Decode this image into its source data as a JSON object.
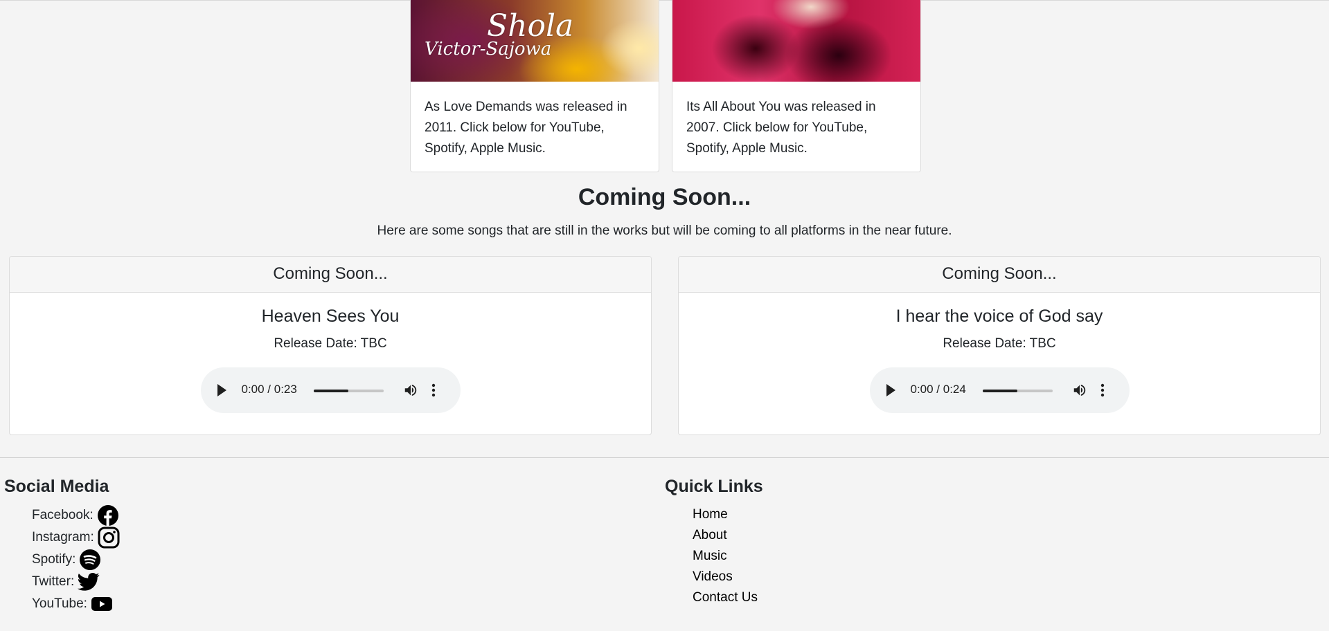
{
  "albums": [
    {
      "script_name": "Shola",
      "script_sub": "Victor-Sajowa",
      "description": "As Love Demands was released in 2011. Click below for YouTube, Spotify, Apple Music."
    },
    {
      "description": "Its All About You was released in 2007. Click below for YouTube, Spotify, Apple Music."
    }
  ],
  "coming_soon": {
    "title": "Coming Soon...",
    "description": "Here are some songs that are still in the works but will be coming to all platforms in the near future.",
    "songs": [
      {
        "header": "Coming Soon...",
        "title": "Heaven Sees You",
        "release": "Release Date: TBC",
        "time": "0:00 / 0:23",
        "volume_level": 0.5
      },
      {
        "header": "Coming Soon...",
        "title": "I hear the voice of God say",
        "release": "Release Date: TBC",
        "time": "0:00 / 0:24",
        "volume_level": 0.5
      }
    ]
  },
  "footer": {
    "social_heading": "Social Media",
    "social": [
      {
        "label": "Facebook:",
        "icon": "facebook-icon"
      },
      {
        "label": "Instagram:",
        "icon": "instagram-icon"
      },
      {
        "label": "Spotify:",
        "icon": "spotify-icon"
      },
      {
        "label": "Twitter:",
        "icon": "twitter-icon"
      },
      {
        "label": "YouTube:",
        "icon": "youtube-icon"
      }
    ],
    "quick_heading": "Quick Links",
    "quick_links": [
      "Home",
      "About",
      "Music",
      "Videos",
      "Contact Us"
    ]
  }
}
